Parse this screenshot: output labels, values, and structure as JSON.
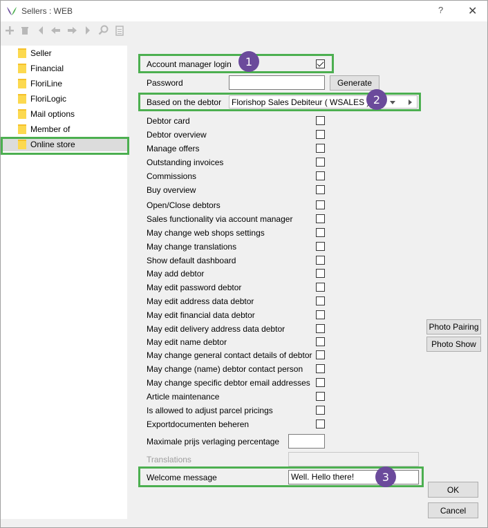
{
  "window": {
    "title": "Sellers : WEB",
    "help": "?",
    "close": "✕"
  },
  "toolbar": {
    "icons": [
      "add-icon",
      "delete-icon",
      "first-icon",
      "prev-icon",
      "next-icon",
      "last-icon",
      "search-icon",
      "document-icon"
    ]
  },
  "nav": {
    "items": [
      {
        "label": "Seller"
      },
      {
        "label": "Financial"
      },
      {
        "label": "FloriLine"
      },
      {
        "label": "FloriLogic"
      },
      {
        "label": "Mail options"
      },
      {
        "label": "Member of"
      },
      {
        "label": "Online store",
        "selected": true
      }
    ]
  },
  "form": {
    "account_manager_login": {
      "label": "Account manager login",
      "checked": true
    },
    "password": {
      "label": "Password",
      "value": "",
      "generate": "Generate"
    },
    "debtor": {
      "label": "Based on the debtor",
      "value": "Florishop Sales Debiteur  ( WSALES )"
    },
    "permissions": [
      {
        "label": "Debtor card",
        "checked": false
      },
      {
        "label": "Debtor overview",
        "checked": false
      },
      {
        "label": "Manage offers",
        "checked": false
      },
      {
        "label": "Outstanding invoices",
        "checked": false
      },
      {
        "label": "Commissions",
        "checked": false
      },
      {
        "label": "Buy overview",
        "checked": false
      },
      {
        "label": "Open/Close debtors",
        "checked": false
      },
      {
        "label": "Sales functionality via account manager",
        "checked": false
      },
      {
        "label": "May change web shops settings",
        "checked": false
      },
      {
        "label": "May change translations",
        "checked": false
      },
      {
        "label": "Show default dashboard",
        "checked": false
      },
      {
        "label": "May add debtor",
        "checked": false
      },
      {
        "label": "May edit password debtor",
        "checked": false
      },
      {
        "label": "May edit address data debtor",
        "checked": false
      },
      {
        "label": "May edit financial data debtor",
        "checked": false
      },
      {
        "label": "May edit delivery address data debtor",
        "checked": false
      },
      {
        "label": "May edit name debtor",
        "checked": false
      },
      {
        "label": "May change general contact details of debtor",
        "checked": false
      },
      {
        "label": "May change (name) debtor contact person",
        "checked": false
      },
      {
        "label": "May change specific debtor email addresses",
        "checked": false
      },
      {
        "label": "Article maintenance",
        "checked": false
      },
      {
        "label": "Is allowed to adjust parcel pricings",
        "checked": false
      },
      {
        "label": "Exportdocumenten beheren",
        "checked": false
      }
    ],
    "max_price": {
      "label": "Maximale prijs verlaging percentage",
      "value": ""
    },
    "translations": {
      "label": "Translations",
      "value": ""
    },
    "welcome": {
      "label": "Welcome message",
      "value": "Well. Hello there!"
    }
  },
  "side_buttons": {
    "photo_pairing": "Photo Pairing",
    "photo_show": "Photo Show",
    "ok": "OK",
    "cancel": "Cancel"
  },
  "annotations": {
    "badge1": "1",
    "badge2": "2",
    "badge3": "3",
    "highlight_color": "#4caf50",
    "badge_color": "#6b4a9b"
  }
}
